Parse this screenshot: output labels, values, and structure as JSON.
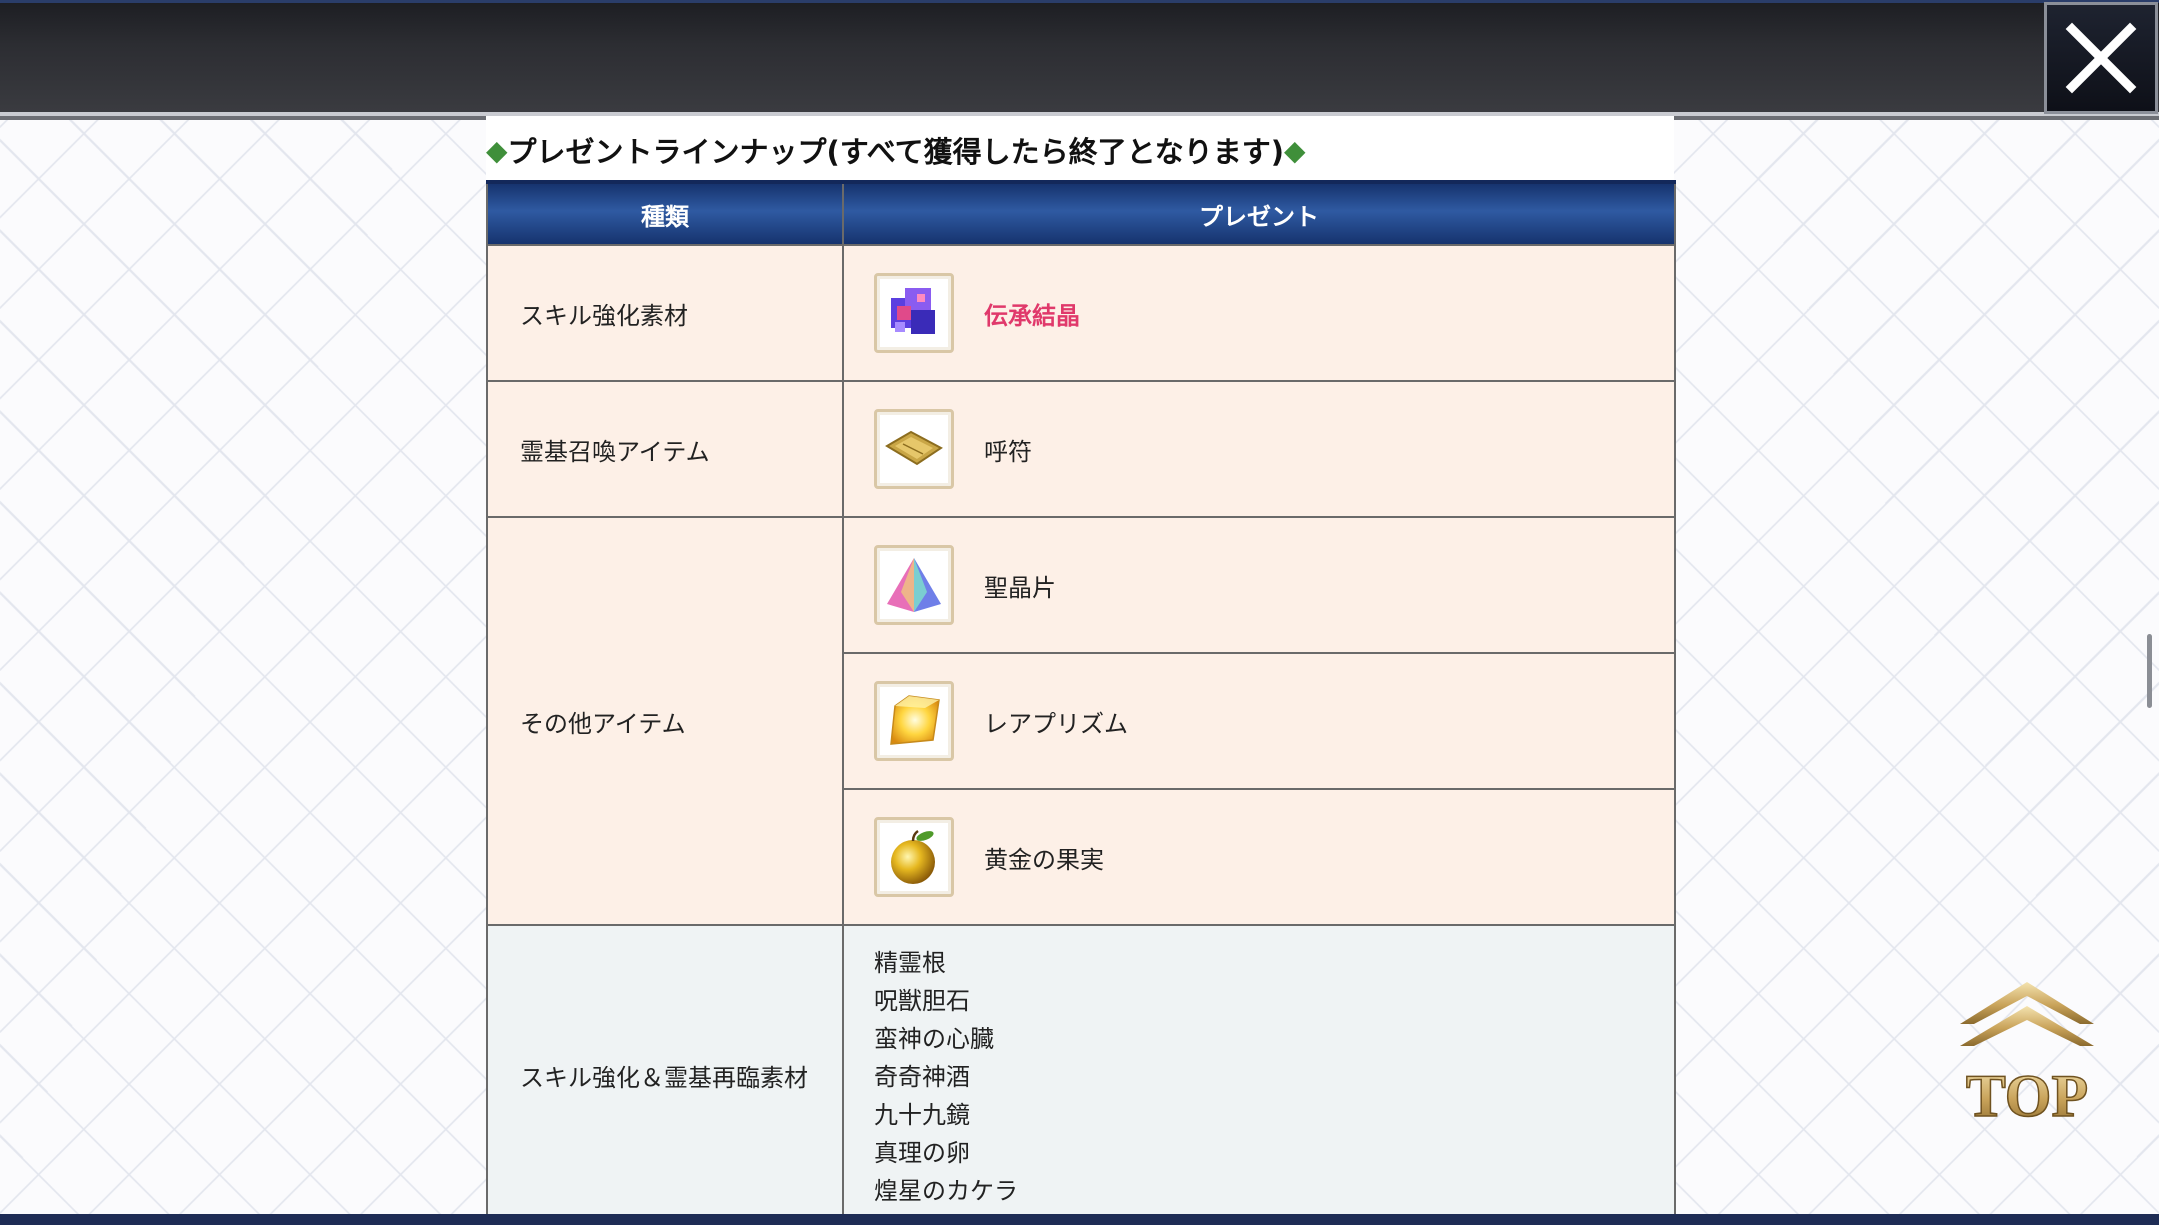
{
  "close_icon": "close-icon",
  "section_title": {
    "diamond_left": "◆",
    "text": "プレゼントラインナップ(すべて獲得したら終了となります)",
    "diamond_right": "◆"
  },
  "table": {
    "headers": {
      "kind": "種類",
      "present": "プレゼント"
    },
    "rows": [
      {
        "kind": "スキル強化素材",
        "items": [
          {
            "name": "伝承結晶",
            "icon": "legend-crystal-icon",
            "highlight": true
          }
        ]
      },
      {
        "kind": "霊基召喚アイテム",
        "items": [
          {
            "name": "呼符",
            "icon": "summon-ticket-icon"
          }
        ]
      },
      {
        "kind": "その他アイテム",
        "items": [
          {
            "name": "聖晶片",
            "icon": "saint-quartz-fragment-icon"
          },
          {
            "name": "レアプリズム",
            "icon": "rare-prism-icon"
          },
          {
            "name": "黄金の果実",
            "icon": "golden-fruit-icon"
          }
        ]
      },
      {
        "kind": "スキル強化＆霊基再臨素材",
        "materials": [
          "精霊根",
          "呪獣胆石",
          "蛮神の心臓",
          "奇奇神酒",
          "九十九鏡",
          "真理の卵",
          "煌星のカケラ"
        ]
      }
    ]
  },
  "top_button": {
    "label": "TOP"
  },
  "colors": {
    "header_blue": "#1d3d7c",
    "row_peach": "#fdf0e7",
    "row_grey": "#eff3f4",
    "highlight_pink": "#e0396b",
    "diamond_green": "#3f8f3a"
  }
}
